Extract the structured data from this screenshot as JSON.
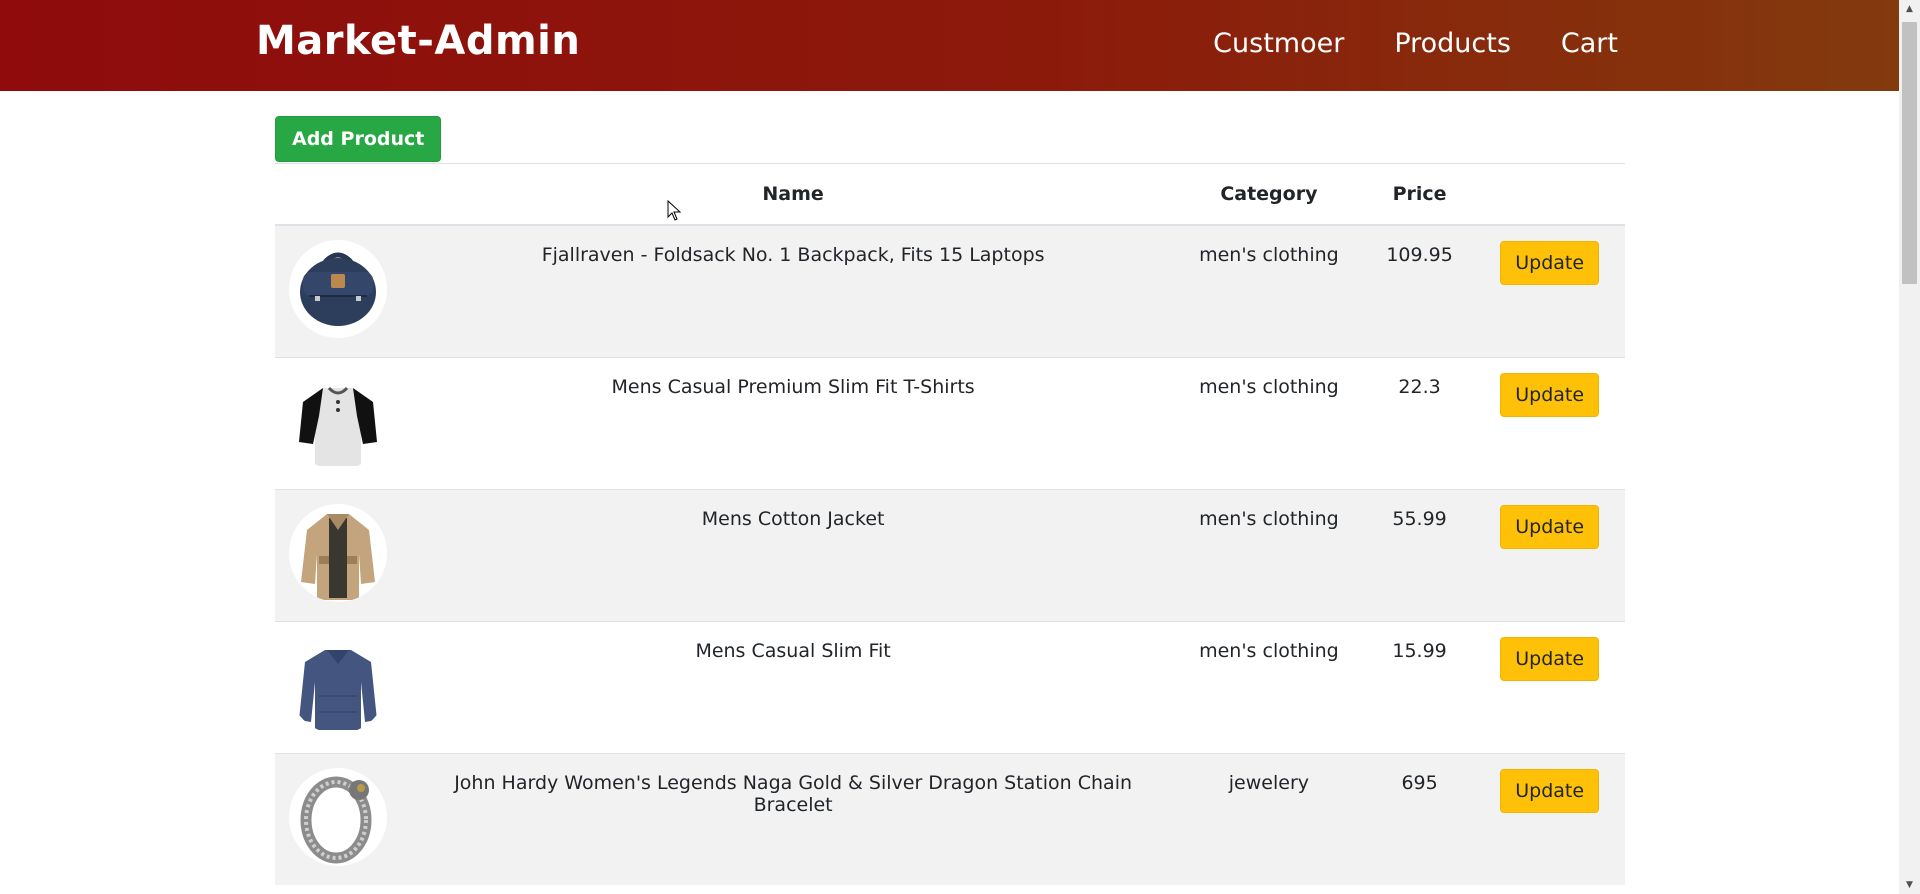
{
  "header": {
    "brand": "Market-Admin",
    "nav": [
      "Custmoer",
      "Products",
      "Cart"
    ]
  },
  "toolbar": {
    "add_label": "Add Product"
  },
  "table": {
    "columns": [
      "",
      "Name",
      "Category",
      "Price",
      ""
    ],
    "rows": [
      {
        "image": "backpack-icon",
        "name": "Fjallraven - Foldsack No. 1 Backpack, Fits 15 Laptops",
        "category": "men's clothing",
        "price": "109.95",
        "action": "Update"
      },
      {
        "image": "tshirt-icon",
        "name": "Mens Casual Premium Slim Fit T-Shirts",
        "category": "men's clothing",
        "price": "22.3",
        "action": "Update"
      },
      {
        "image": "jacket-icon",
        "name": "Mens Cotton Jacket",
        "category": "men's clothing",
        "price": "55.99",
        "action": "Update"
      },
      {
        "image": "longsleeve-icon",
        "name": "Mens Casual Slim Fit",
        "category": "men's clothing",
        "price": "15.99",
        "action": "Update"
      },
      {
        "image": "bracelet-icon",
        "name": "John Hardy Women's Legends Naga Gold & Silver Dragon Station Chain Bracelet",
        "category": "jewelery",
        "price": "695",
        "action": "Update"
      }
    ]
  },
  "colors": {
    "navbar_start": "#8f0b0c",
    "navbar_end": "#833a0d",
    "add_button": "#28a745",
    "update_button": "#ffc107"
  }
}
